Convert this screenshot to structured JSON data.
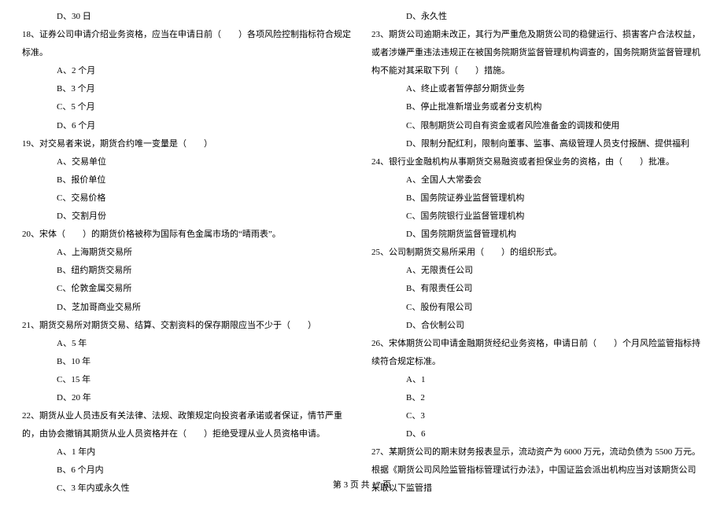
{
  "left": {
    "l0": "D、30 日",
    "q18": "18、证券公司申请介绍业务资格，应当在申请日前（　　）各项风险控制指标符合规定标准。",
    "q18a": "A、2 个月",
    "q18b": "B、3 个月",
    "q18c": "C、5 个月",
    "q18d": "D、6 个月",
    "q19": "19、对交易者来说，期货合约唯一变量是（　　）",
    "q19a": "A、交易单位",
    "q19b": "B、报价单位",
    "q19c": "C、交易价格",
    "q19d": "D、交割月份",
    "q20": "20、宋体（　　）的期货价格被称为国际有色金属市场的“晴雨表”。",
    "q20a": "A、上海期货交易所",
    "q20b": "B、纽约期货交易所",
    "q20c": "C、伦敦金属交易所",
    "q20d": "D、芝加哥商业交易所",
    "q21": "21、期货交易所对期货交易、结算、交割资料的保存期限应当不少于（　　）",
    "q21a": "A、5 年",
    "q21b": "B、10 年",
    "q21c": "C、15 年",
    "q21d": "D、20 年",
    "q22": "22、期货从业人员违反有关法律、法规、政策规定向投资者承诺或者保证，情节严重的，由协会撤销其期货从业人员资格并在（　　）拒绝受理从业人员资格申请。",
    "q22a": "A、1 年内",
    "q22b": "B、6 个月内",
    "q22c": "C、3 年内或永久性"
  },
  "right": {
    "r0": "D、永久性",
    "q23": "23、期货公司逾期未改正，其行为严重危及期货公司的稳健运行、损害客户合法权益，或者涉嫌严重违法违规正在被国务院期货监督管理机构调查的，国务院期货监督管理机构不能对其采取下列（　　）措施。",
    "q23a": "A、终止或者暂停部分期货业务",
    "q23b": "B、停止批准新增业务或者分支机构",
    "q23c": "C、限制期货公司自有资金或者风险准备金的调拨和使用",
    "q23d": "D、限制分配红利，限制向董事、监事、高级管理人员支付报酬、提供福利",
    "q24": "24、银行业金融机构从事期货交易融资或者担保业务的资格，由（　　）批准。",
    "q24a": "A、全国人大常委会",
    "q24b": "B、国务院证券业监督管理机构",
    "q24c": "C、国务院银行业监督管理机构",
    "q24d": "D、国务院期货监督管理机构",
    "q25": "25、公司制期货交易所采用（　　）的组织形式。",
    "q25a": "A、无限责任公司",
    "q25b": "B、有限责任公司",
    "q25c": "C、股份有限公司",
    "q25d": "D、合伙制公司",
    "q26": "26、宋体期货公司申请金融期货经纪业务资格，申请日前（　　）个月风险监管指标持续符合规定标准。",
    "q26a": "A、1",
    "q26b": "B、2",
    "q26c": "C、3",
    "q26d": "D、6",
    "q27": "27、某期货公司的期末财务报表显示，流动资产为 6000 万元，流动负债为 5500 万元。根据《期货公司风险监管指标管理试行办法》，中国证监会派出机构应当对该期货公司采取以下监管措"
  },
  "footer": "第 3 页 共 17 页"
}
